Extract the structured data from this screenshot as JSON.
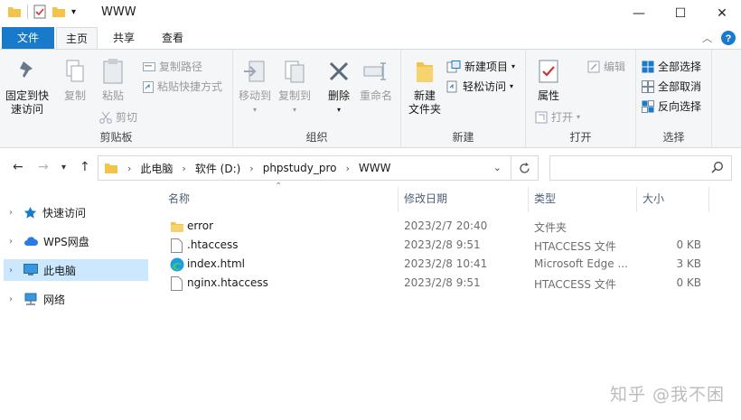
{
  "window": {
    "title": "WWW",
    "minimize": "—",
    "maximize": "☐",
    "close": "✕"
  },
  "tabs": {
    "file": "文件",
    "home": "主页",
    "share": "共享",
    "view": "查看"
  },
  "ribbon": {
    "clipboard": {
      "label": "剪贴板",
      "pin_line1": "固定到快",
      "pin_line2": "速访问",
      "copy": "复制",
      "paste": "粘贴",
      "copy_path": "复制路径",
      "paste_shortcut": "粘贴快捷方式",
      "cut": "剪切"
    },
    "organize": {
      "label": "组织",
      "move_to": "移动到",
      "copy_to": "复制到",
      "delete": "删除",
      "rename": "重命名"
    },
    "new": {
      "label": "新建",
      "new_folder_line1": "新建",
      "new_folder_line2": "文件夹",
      "new_item": "新建项目",
      "easy_access": "轻松访问"
    },
    "open": {
      "label": "打开",
      "properties": "属性",
      "open": "打开",
      "edit": "编辑"
    },
    "select": {
      "label": "选择",
      "select_all": "全部选择",
      "select_none": "全部取消",
      "invert": "反向选择"
    }
  },
  "address": {
    "crumbs": [
      "此电脑",
      "软件 (D:)",
      "phpstudy_pro",
      "WWW"
    ]
  },
  "sidebar": {
    "items": [
      {
        "label": "快速访问"
      },
      {
        "label": "WPS网盘"
      },
      {
        "label": "此电脑"
      },
      {
        "label": "网络"
      }
    ]
  },
  "columns": {
    "name": "名称",
    "modified": "修改日期",
    "type": "类型",
    "size": "大小"
  },
  "files": [
    {
      "name": "error",
      "modified": "2023/2/7 20:40",
      "type": "文件夹",
      "size": "",
      "icon": "folder-icon"
    },
    {
      "name": ".htaccess",
      "modified": "2023/2/8 9:51",
      "type": "HTACCESS 文件",
      "size": "0 KB",
      "icon": "file-icon"
    },
    {
      "name": "index.html",
      "modified": "2023/2/8 10:41",
      "type": "Microsoft Edge ...",
      "size": "3 KB",
      "icon": "edge-icon"
    },
    {
      "name": "nginx.htaccess",
      "modified": "2023/2/8 9:51",
      "type": "HTACCESS 文件",
      "size": "0 KB",
      "icon": "file-icon"
    }
  ],
  "watermark": "知乎 @我不困",
  "colors": {
    "accent": "#1979ca",
    "selected": "#cce8ff",
    "folder": "#f3c34a"
  }
}
